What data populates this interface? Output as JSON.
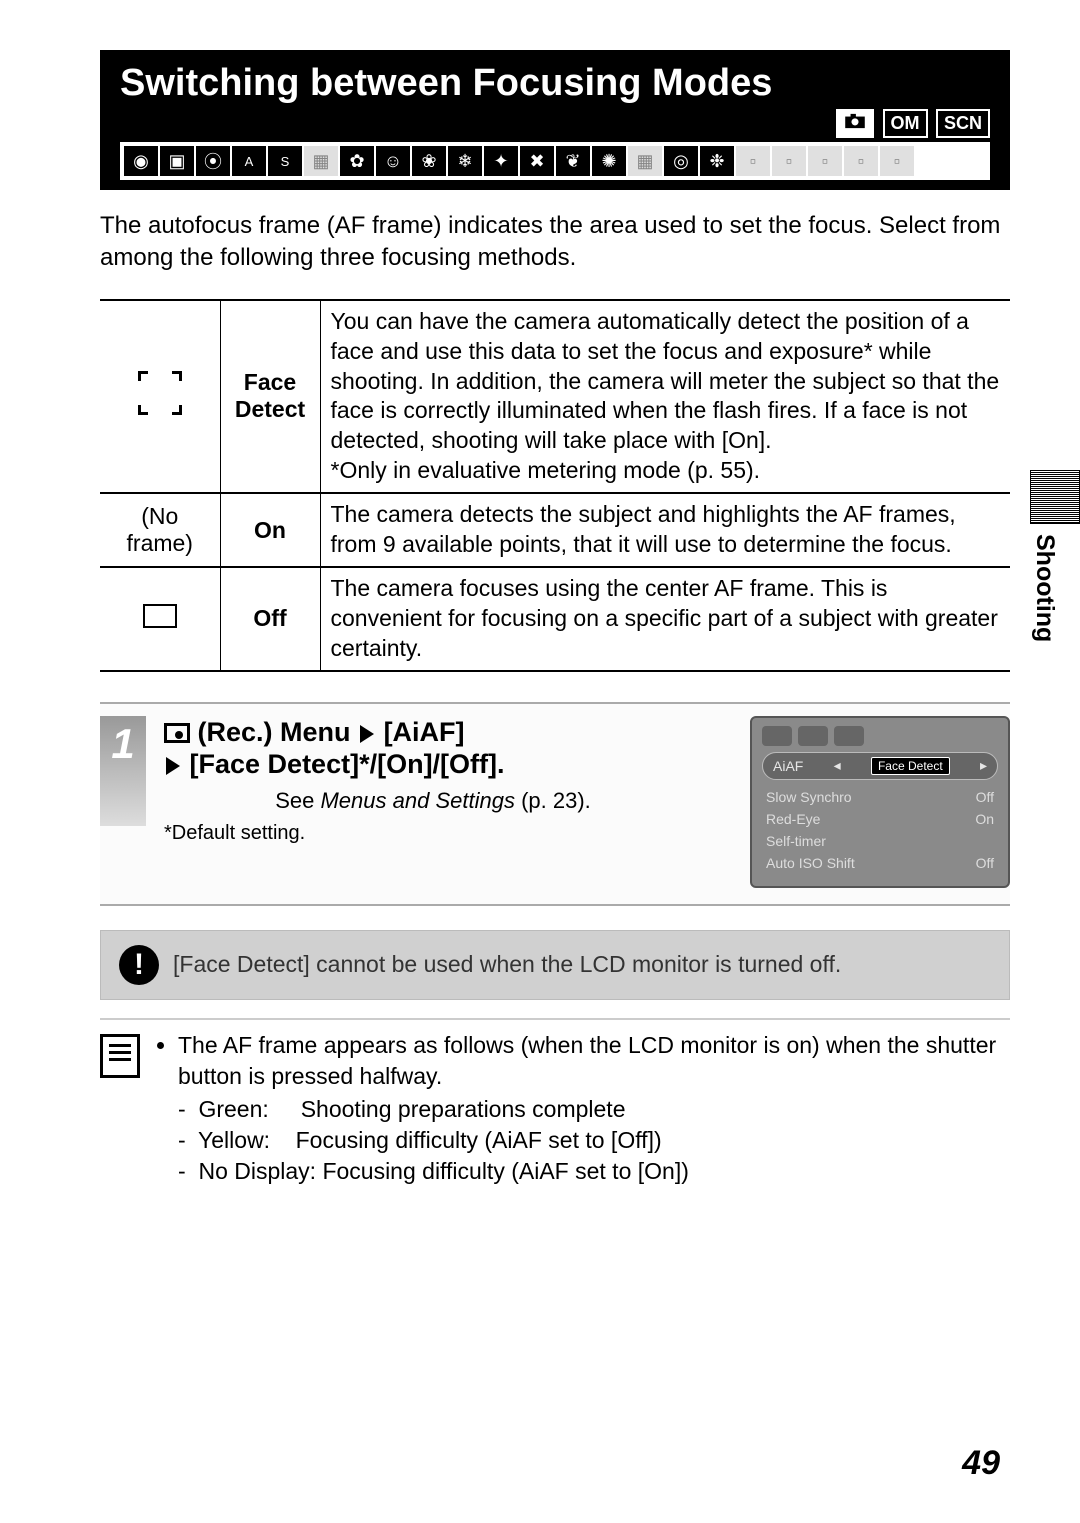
{
  "header": {
    "title": "Switching between Focusing Modes",
    "mode_badges": [
      "camera",
      "OM",
      "SCN"
    ]
  },
  "intro": "The autofocus frame (AF frame) indicates the area used to set the focus. Select from among the following three focusing methods.",
  "table": {
    "rows": [
      {
        "icon_label": "",
        "name": "Face Detect",
        "desc": "You can have the camera automatically detect the position of a face and use this data to set the focus and exposure* while shooting. In addition, the camera will meter the subject so that the face is correctly illuminated when the flash fires. If a face is not detected, shooting will take place with [On].\n*Only in evaluative metering mode (p. 55)."
      },
      {
        "icon_label": "(No frame)",
        "name": "On",
        "desc": "The camera detects the subject and highlights the AF frames, from 9 available points, that it will use to determine the focus."
      },
      {
        "icon_label": "",
        "name": "Off",
        "desc": "The camera focuses using the center AF frame. This is convenient for focusing on a specific part of a subject with greater certainty."
      }
    ]
  },
  "step": {
    "number": "1",
    "title_prefix": "(Rec.) Menu",
    "title_item": "[AiAF]",
    "title_options": "[Face Detect]*/[On]/[Off].",
    "see_text": "See Menus and Settings (p. 23).",
    "default_text": "*Default setting."
  },
  "menu_sim": {
    "pill_label": "AiAF",
    "pill_value": "Face Detect",
    "rows": [
      {
        "label": "Slow Synchro",
        "value": "Off"
      },
      {
        "label": "Red-Eye",
        "value": "On"
      },
      {
        "label": "Self-timer",
        "value": ""
      },
      {
        "label": "Auto ISO Shift",
        "value": "Off"
      }
    ]
  },
  "note": "[Face Detect] cannot be used when the LCD monitor is turned off.",
  "memo": {
    "lead": "The AF frame appears as follows (when the LCD monitor is on) when the shutter button is pressed halfway.",
    "items": [
      "Green:     Shooting preparations complete",
      "Yellow:    Focusing difficulty (AiAF set to [Off])",
      "No Display: Focusing difficulty (AiAF set to [On])"
    ]
  },
  "side_tab": "Shooting",
  "page_number": "49"
}
